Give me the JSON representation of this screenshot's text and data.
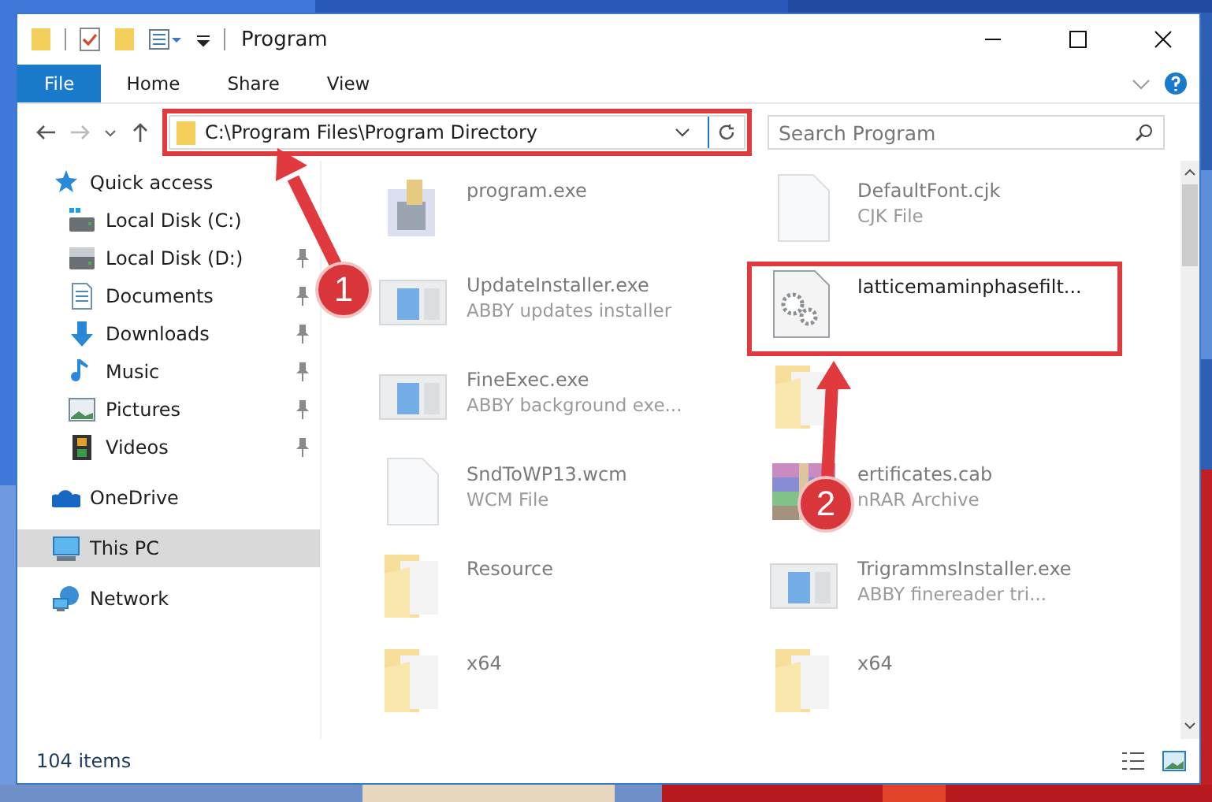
{
  "window": {
    "title": "Program"
  },
  "ribbon_tabs": [
    {
      "label": "File",
      "kind": "file"
    },
    {
      "label": "Home",
      "kind": "tab"
    },
    {
      "label": "Share",
      "kind": "tab"
    },
    {
      "label": "View",
      "kind": "tab"
    }
  ],
  "address_bar": {
    "value": "C:\\Program Files\\Program Directory",
    "highlighted": true
  },
  "search": {
    "placeholder": "Search Program"
  },
  "sidebar": {
    "items": [
      {
        "label": "Quick access",
        "kind": "star",
        "selected": false,
        "children": [
          {
            "label": "Local Disk (C:)",
            "kind": "drive-win",
            "selected": false,
            "pinned": false
          },
          {
            "label": "Local Disk (D:)",
            "kind": "drive",
            "selected": false,
            "pinned": true
          },
          {
            "label": "Documents",
            "kind": "documents",
            "selected": false,
            "pinned": true
          },
          {
            "label": "Downloads",
            "kind": "downloads",
            "selected": false,
            "pinned": true
          },
          {
            "label": "Music",
            "kind": "music",
            "selected": false,
            "pinned": true
          },
          {
            "label": "Pictures",
            "kind": "pictures",
            "selected": false,
            "pinned": true
          },
          {
            "label": "Videos",
            "kind": "videos",
            "selected": false,
            "pinned": true
          }
        ]
      },
      {
        "label": "OneDrive",
        "kind": "cloud",
        "selected": false
      },
      {
        "label": "This PC",
        "kind": "pc",
        "selected": true
      },
      {
        "label": "Network",
        "kind": "network",
        "selected": false
      }
    ]
  },
  "files": [
    {
      "name": "program.exe",
      "kind": "setup",
      "dimmed": true,
      "highlighted": false
    },
    {
      "name": "DefaultFont.cjk",
      "type": "CJK File",
      "kind": "document",
      "dimmed": true,
      "highlighted": false
    },
    {
      "name": "UpdateInstaller.exe",
      "type": "ABBY updates installer",
      "kind": "app",
      "dimmed": true,
      "highlighted": false
    },
    {
      "name": "latticemaminphasefilt...",
      "kind": "gear",
      "dimmed": false,
      "highlighted": true
    },
    {
      "name": "FineExec.exe",
      "type": "ABBY background exe...",
      "kind": "app",
      "dimmed": true,
      "highlighted": false
    },
    {
      "kind": "folder",
      "dimmed": true,
      "highlighted": false
    },
    {
      "name": "SndToWP13.wcm",
      "type": "WCM File",
      "kind": "document",
      "dimmed": true,
      "highlighted": false
    },
    {
      "name": "ertificates.cab",
      "type": "nRAR Archive",
      "kind": "archive",
      "dimmed": true,
      "highlighted": false
    },
    {
      "name": "Resource",
      "kind": "folder",
      "dimmed": true,
      "highlighted": false
    },
    {
      "name": "TrigrammsInstaller.exe",
      "type": "ABBY finereader tri...",
      "kind": "app",
      "dimmed": true,
      "highlighted": false
    },
    {
      "name": "x64",
      "kind": "folder",
      "dimmed": true,
      "highlighted": false
    },
    {
      "name": "x64",
      "kind": "folder",
      "dimmed": true,
      "highlighted": false
    }
  ],
  "status_bar": {
    "item_count": "104 items"
  },
  "annotations": [
    {
      "number": "1"
    },
    {
      "number": "2"
    }
  ]
}
